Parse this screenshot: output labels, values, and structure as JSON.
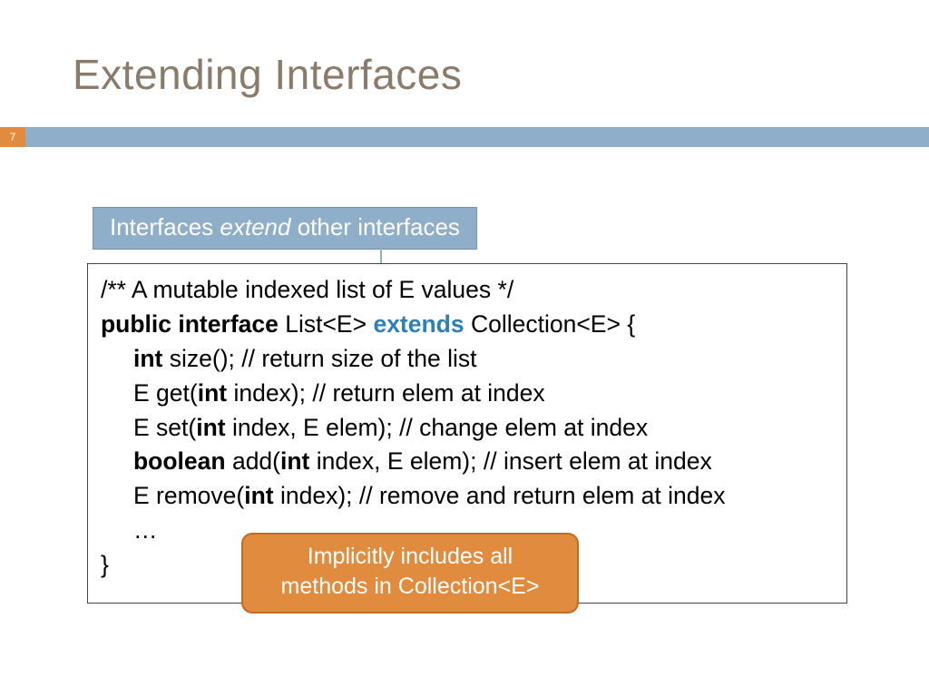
{
  "page_number": "7",
  "title": "Extending Interfaces",
  "callout_top": {
    "pre": "Interfaces ",
    "em": "extend",
    "post": " other interfaces"
  },
  "code": {
    "c0": "/** A mutable indexed list of E values */",
    "l1_kw1": "public interface ",
    "l1_mid": "List<E> ",
    "l1_ext": "extends",
    "l1_end": " Collection<E> {",
    "l2_kw": "int ",
    "l2_rest": "size(); // return size of the list",
    "l3_a": "E get(",
    "l3_kw": "int ",
    "l3_b": "index); // return elem at index",
    "l4_a": "E set(",
    "l4_kw": "int ",
    "l4_b": "index, E elem); // change elem at index",
    "l5_kw1": "boolean ",
    "l5_a": "add(",
    "l5_kw2": "int ",
    "l5_b": "index, E elem); // insert elem at index",
    "l6_a": "E remove(",
    "l6_kw": "int ",
    "l6_b": "index); // remove and return elem at index",
    "l7": "…",
    "l8": "}"
  },
  "callout_bot_l1": "Implicitly includes all",
  "callout_bot_l2": "methods in Collection<E>"
}
